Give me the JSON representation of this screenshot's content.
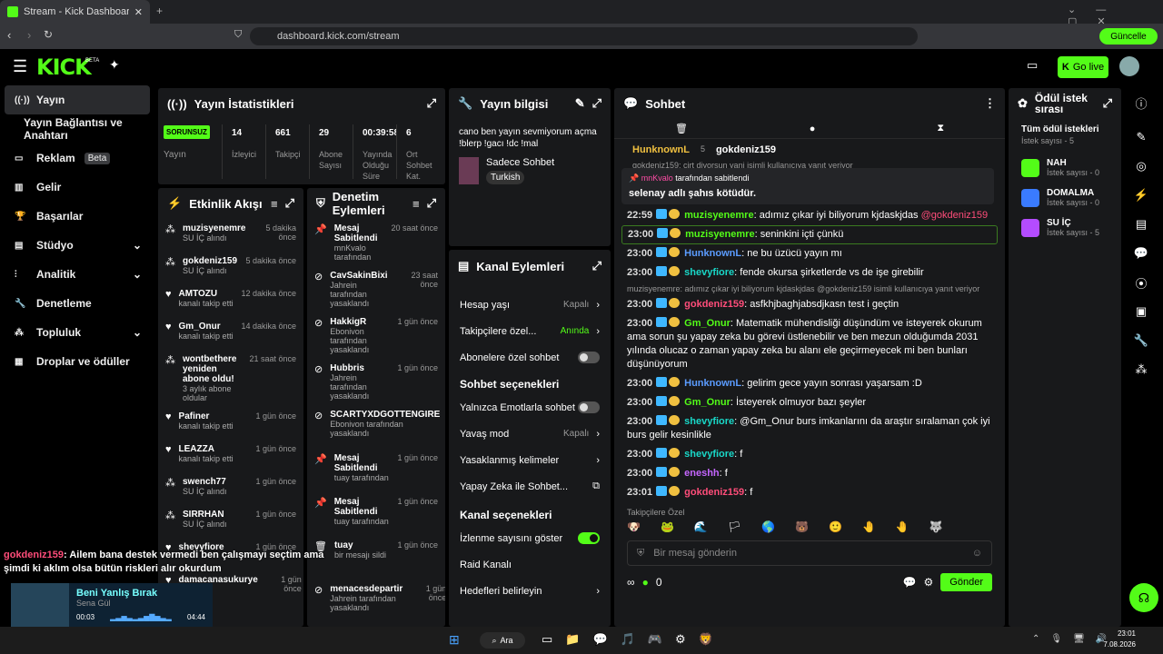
{
  "browser": {
    "tab_title": "Stream - Kick Dashboard",
    "url": "dashboard.kick.com/stream",
    "update_label": "Güncelle"
  },
  "header": {
    "logo": "KICK",
    "logo_sup": "BETA",
    "go_live": "Go live"
  },
  "sidebar": {
    "items": [
      {
        "label": "Yayın",
        "icon": "broadcast-icon",
        "active": true
      },
      {
        "label": "Yayın Bağlantısı ve Anahtarı",
        "icon": ""
      },
      {
        "label": "Reklam",
        "icon": "tv-icon",
        "badge": "Beta"
      },
      {
        "label": "Gelir",
        "icon": "chart-icon"
      },
      {
        "label": "Başarılar",
        "icon": "trophy-icon"
      },
      {
        "label": "Stüdyo",
        "icon": "studio-icon",
        "chevron": true
      },
      {
        "label": "Analitik",
        "icon": "analytics-icon",
        "chevron": true
      },
      {
        "label": "Denetleme",
        "icon": "wrench-icon"
      },
      {
        "label": "Topluluk",
        "icon": "community-icon",
        "chevron": true
      },
      {
        "label": "Droplar ve ödüller",
        "icon": "gift-icon"
      }
    ]
  },
  "stats": {
    "title": "Yayın İstatistikleri",
    "status": "SORUNSUZ",
    "status_label": "Yayın",
    "items": [
      {
        "value": "14",
        "label": "İzleyici"
      },
      {
        "value": "661",
        "label": "Takipçi"
      },
      {
        "value": "29",
        "label": "Abone Sayısı"
      },
      {
        "value": "00:39:58",
        "label": "Yayında Olduğu Süre"
      },
      {
        "value": "6",
        "label": "Ort Sohbet Kat."
      }
    ]
  },
  "activity": {
    "title": "Etkinlik Akışı",
    "items": [
      {
        "name": "muzisyenemre",
        "sub": "SU İÇ alındı",
        "time": "5 dakika önce",
        "green": true
      },
      {
        "name": "gokdeniz159",
        "sub": "SU İÇ alındı",
        "time": "5 dakika önce",
        "green": true
      },
      {
        "name": "AMTOZU",
        "sub": "kanalı takip etti",
        "time": "12 dakika önce"
      },
      {
        "name": "Gm_Onur",
        "sub": "kanalı takip etti",
        "time": "14 dakika önce"
      },
      {
        "name": "wontbethere yeniden abone oldu!",
        "sub": "3 aylık abone oldular",
        "time": "21 saat önce",
        "green": true
      },
      {
        "name": "Pafiner",
        "sub": "kanalı takip etti",
        "time": "1 gün önce"
      },
      {
        "name": "LEAZZA",
        "sub": "kanalı takip etti",
        "time": "1 gün önce"
      },
      {
        "name": "swench77",
        "sub": "SU İÇ alındı",
        "time": "1 gün önce",
        "green": true
      },
      {
        "name": "SIRRHAN",
        "sub": "SU İÇ alındı",
        "time": "1 gün önce",
        "green": true
      },
      {
        "name": "shevyfiore",
        "sub": "",
        "time": "1 gün önce"
      },
      {
        "name": "damacanasukurye",
        "sub": "",
        "time": "1 gün önce"
      }
    ]
  },
  "moderation": {
    "title": "Denetim Eylemleri",
    "items": [
      {
        "name": "Mesaj Sabitlendi",
        "sub": "mnKvalo tarafından",
        "time": "20 saat önce"
      },
      {
        "name": "CavSakinBixi",
        "sub": "Jahrein tarafından yasaklandı",
        "time": "23 saat önce"
      },
      {
        "name": "HakkigR",
        "sub": "Ebonivon tarafından yasaklandı",
        "time": "1 gün önce"
      },
      {
        "name": "Hubbris",
        "sub": "Jahrein tarafından yasaklandı",
        "time": "1 gün önce"
      },
      {
        "name": "SCARTYXDGOTTENGIRE",
        "sub": "Ebonivon tarafından yasaklandı",
        "time": ""
      },
      {
        "name": "Mesaj Sabitlendi",
        "sub": "tuay tarafından",
        "time": "1 gün önce"
      },
      {
        "name": "Mesaj Sabitlendi",
        "sub": "tuay tarafından",
        "time": "1 gün önce"
      },
      {
        "name": "tuay",
        "sub": "bir mesajı sildi",
        "time": "1 gün önce"
      },
      {
        "name": "menacesdepartir",
        "sub": "Jahrein tarafından yasaklandı",
        "time": "1 gün önce"
      }
    ]
  },
  "info": {
    "title": "Yayın bilgisi",
    "stream_title": "cano ben yayın sevmiyorum açma !blerp !gacı !dc !mal",
    "category": "Sadece Sohbet",
    "tag": "Turkish"
  },
  "channel": {
    "title": "Kanal Eylemleri",
    "rows": [
      {
        "label": "Hesap yaşı",
        "value": "Kapalı",
        "type": "chevron"
      },
      {
        "label": "Takipçilere özel...",
        "value": "Anında",
        "type": "chevron",
        "green": true
      },
      {
        "label": "Abonelere özel sohbet",
        "type": "toggle",
        "on": false
      }
    ],
    "chat_opts_title": "Sohbet seçenekleri",
    "chat_rows": [
      {
        "label": "Yalnızca Emotlarla sohbet",
        "type": "toggle",
        "on": false
      },
      {
        "label": "Yavaş mod",
        "value": "Kapalı",
        "type": "chevron"
      },
      {
        "label": "Yasaklanmış kelimeler",
        "type": "chevron"
      },
      {
        "label": "Yapay Zeka ile Sohbet...",
        "type": "ext"
      }
    ],
    "channel_opts_title": "Kanal seçenekleri",
    "chan_rows": [
      {
        "label": "İzlenme sayısını göster",
        "type": "toggle",
        "on": true
      },
      {
        "label": "Raid Kanalı",
        "type": "none"
      },
      {
        "label": "Hedefleri belirleyin",
        "type": "chevron"
      }
    ]
  },
  "chat": {
    "title": "Sohbet",
    "top_user1": "HunknownL",
    "top_user1_count": "5",
    "top_user2": "gokdeniz159",
    "reply_note": "gokdeniz159: cirt diyorsun yani isimli kullanıcıya yanıt veriyor",
    "pinned_by": "mnKvalo",
    "pinned_by_suffix": "tarafından sabitlendi",
    "pinned_text": "selenay adlı şahıs kötüdür.",
    "messages": [
      {
        "ts": "22:59",
        "user": "muzisyenemre",
        "color": "#53fc18",
        "text": "adımız çıkar iyi biliyorum kjdaskjdas",
        "mention": "@gokdeniz159"
      },
      {
        "ts": "23:00",
        "user": "muzisyenemre",
        "color": "#53fc18",
        "text": "seninkini içti çünkü",
        "hl": true
      },
      {
        "ts": "23:00",
        "user": "HunknownL",
        "color": "#5b9cff",
        "text": "ne bu üzücü yayın mı"
      },
      {
        "ts": "23:00",
        "user": "shevyfiore",
        "color": "#19d8c8",
        "text": "fende okursa şirketlerde vs de işe girebilir"
      },
      {
        "reply": "muzisyenemre: adımız çıkar iyi biliyorum kjdaskjdas @gokdeniz159 isimli kullanıcıya yanıt veriyor"
      },
      {
        "ts": "23:00",
        "user": "gokdeniz159",
        "color": "#ff4d7a",
        "text": "asfkhjbaghjabsdjkasn test i geçtin"
      },
      {
        "ts": "23:00",
        "user": "Gm_Onur",
        "color": "#53fc18",
        "text": "Matematik mühendisliği düşündüm ve isteyerek okurum ama sorun şu yapay zeka bu görevi üstlenebilir ve ben mezun olduğumda 2031 yılında olucaz o zaman yapay zeka bu alanı ele geçirmeyecek mi ben bunları düşünüyorum"
      },
      {
        "ts": "23:00",
        "user": "HunknownL",
        "color": "#5b9cff",
        "text": "gelirim gece yayın sonrası yaşarsam :D"
      },
      {
        "ts": "23:00",
        "user": "Gm_Onur",
        "color": "#53fc18",
        "text": "İsteyerek olmuyor bazı şeyler"
      },
      {
        "ts": "23:00",
        "user": "shevyfiore",
        "color": "#19d8c8",
        "text": "@Gm_Onur burs imkanlarını da araştır sıralaman çok iyi burs gelir kesinlikle"
      },
      {
        "ts": "23:00",
        "user": "shevyfiore",
        "color": "#19d8c8",
        "text": "f"
      },
      {
        "ts": "23:00",
        "user": "eneshh",
        "color": "#c566ff",
        "text": "f"
      },
      {
        "ts": "23:01",
        "user": "gokdeniz159",
        "color": "#ff4d7a",
        "text": "f"
      },
      {
        "ts": "23:01",
        "user": "gokdeniz159",
        "color": "#ff4d7a",
        "text": "Ailem bana destek vermedi ben çalışmayı seçtim ama şimdi ki aklım olsa bütün riskleri alır okurdum"
      }
    ],
    "followers_only": "Takipçilere Özel",
    "placeholder": "Bir mesaj gönderin",
    "send": "Gönder",
    "points": "0"
  },
  "rewards": {
    "title": "Ödül istek sırası",
    "all": "Tüm ödül istekleri",
    "all_count": "İstek sayısı - 5",
    "items": [
      {
        "name": "NAH",
        "count": "İstek sayısı - 0",
        "color": "#53fc18"
      },
      {
        "name": "DOMALMA",
        "count": "İstek sayısı - 0",
        "color": "#3a7bff"
      },
      {
        "name": "SU İÇ",
        "count": "İstek sayısı - 5",
        "color": "#b44cff"
      }
    ]
  },
  "overlay": {
    "user": "gokdeniz159",
    "text": ": Ailem bana destek vermedi ben çalışmayı seçtim ama şimdi ki aklım olsa bütün riskleri alır okurdum",
    "song": "Beni Yanlış Bırak",
    "artist": "Sena Gül",
    "t_start": "00:03",
    "t_end": "04:44"
  },
  "taskbar": {
    "search": "Ara",
    "time": "23:01",
    "date": "7.08.2026"
  }
}
